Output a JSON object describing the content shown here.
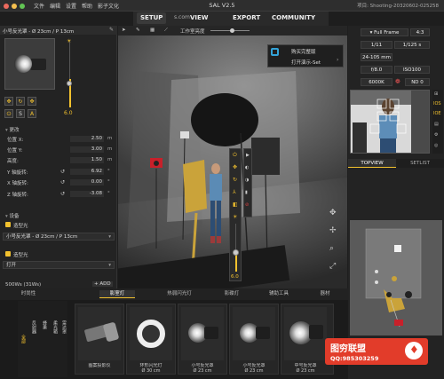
{
  "titlebar": {
    "menus": [
      "文件",
      "编辑",
      "设置",
      "帮助",
      "影子文化"
    ],
    "app_title": "SAL V2.5",
    "file_name": "项目: Shooting-20320602-025258"
  },
  "tabs": {
    "setup": "SETUP",
    "view": "VIEW",
    "export": "EXPORT",
    "community": "COMMUNITY",
    "partial_left": "s.com"
  },
  "left": {
    "header": "小号反光罩 - Ø 23cm / P 13cm",
    "power_value": "6.0",
    "section_change": "更改",
    "props": [
      {
        "label": "位置 X:",
        "value": "2.50",
        "unit": "m"
      },
      {
        "label": "位置 Y:",
        "value": "3.00",
        "unit": "m"
      },
      {
        "label": "高度:",
        "value": "1.50",
        "unit": "m"
      },
      {
        "label": "Y 轴旋转:",
        "value": "6.92",
        "unit": "°"
      },
      {
        "label": "X 轴旋转:",
        "value": "0.00",
        "unit": "°"
      },
      {
        "label": "Z 轴旋转:",
        "value": "-3.08",
        "unit": "°"
      }
    ],
    "section_settings": "设备",
    "modifier_label": "造型光",
    "modifier_value": "小号反光罩 - Ø 23cm / P 13cm",
    "light_label": "造型光",
    "light_value": "打开",
    "power_text": "500Ws (31Ws)",
    "add_button": "+ ADD",
    "btn_s": "S",
    "btn_a": "A"
  },
  "viewport": {
    "toolbar_label": "工作室亮度",
    "popup_items": [
      "购买完整版",
      "打开演示-Set"
    ],
    "power_value": "6.0"
  },
  "right": {
    "full_frame": "Full Frame",
    "ratio": "4:3",
    "time": "1/11",
    "shutter": "1/125 s",
    "lens": "24-105 mm",
    "aperture": "f/8.0",
    "iso": "ISO100",
    "temp": "6000K",
    "nd": "ND 0",
    "tab_topview": "TOPVIEW",
    "tab_setlist": "SETLIST",
    "side_labels": [
      "IOS",
      "IOE"
    ]
  },
  "bottom": {
    "tabs": [
      "时尚性",
      "影室灯",
      "热弱闪光灯",
      "影碟灯",
      "辅助工具",
      "器材"
    ],
    "active_tab": 1,
    "vtabs": [
      "全部",
      "反射器",
      "蜂巢",
      "柔光箱",
      "雷达罩"
    ],
    "cards": [
      {
        "label": "图案投影仪"
      },
      {
        "label": "环形闪光灯",
        "sub": "Ø 30 cm"
      },
      {
        "label": "小号反光罩",
        "sub": "Ø 23 cm"
      },
      {
        "label": "小号反光罩",
        "sub": "Ø 23 cm"
      },
      {
        "label": "中号反光罩",
        "sub": "Ø 23 cm"
      }
    ]
  },
  "watermark": {
    "title": "图穷联盟",
    "qq": "QQ:985303259"
  },
  "colors": {
    "accent": "#f2c12e",
    "brand_red": "#e23c2a"
  }
}
